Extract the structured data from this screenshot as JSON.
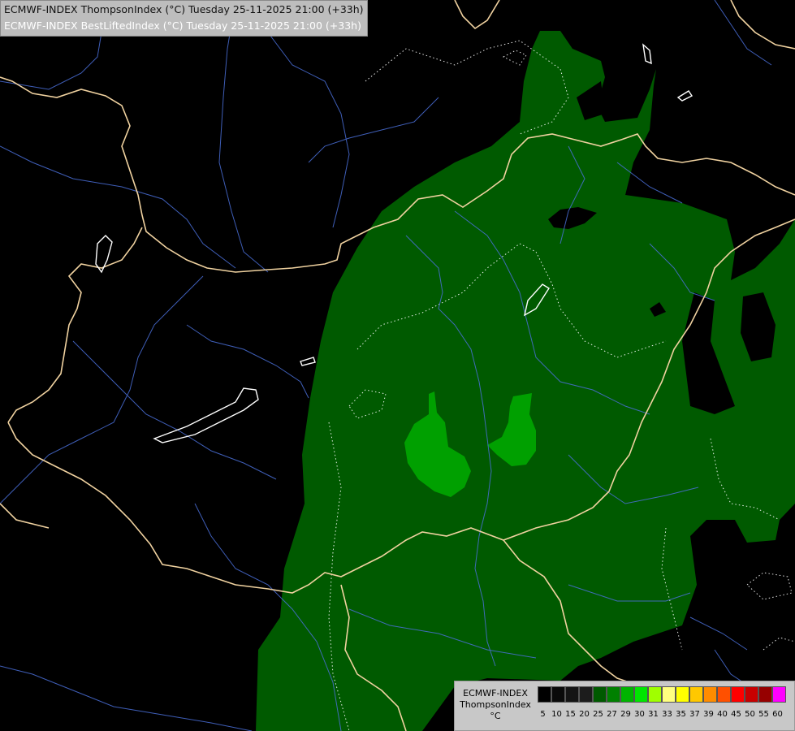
{
  "title": {
    "line1": "ECMWF-INDEX ThompsonIndex (°C) Tuesday 25-11-2025 21:00 (+33h)",
    "line2": "ECMWF-INDEX BestLiftedIndex (°C) Tuesday 25-11-2025 21:00 (+33h)"
  },
  "legend": {
    "label_line1": "ECMWF-INDEX",
    "label_line2": "ThompsonIndex",
    "label_line3": "°C",
    "colors": [
      "#000000",
      "#0a0a0a",
      "#141414",
      "#1c1c1c",
      "#005a00",
      "#008000",
      "#00b400",
      "#00e600",
      "#a0ff00",
      "#ffff80",
      "#ffff00",
      "#ffc800",
      "#ff8c00",
      "#ff5000",
      "#ff0000",
      "#c80000",
      "#960000",
      "#ff00ff",
      "#c800ff",
      "#8c00ff",
      "#5a00ff",
      "#0000ff"
    ],
    "ticks": [
      "5",
      "10",
      "15",
      "20",
      "25",
      "27",
      "29",
      "30",
      "31",
      "33",
      "35",
      "37",
      "39",
      "40",
      "45",
      "50",
      "55",
      "60"
    ]
  },
  "map": {
    "colors": {
      "background": "#000000",
      "field_dark": "#005a00",
      "field_light": "#00a000",
      "borders": "#f0d2a0",
      "rivers": "#4a6fd8",
      "lakes": "#ffffff"
    }
  }
}
